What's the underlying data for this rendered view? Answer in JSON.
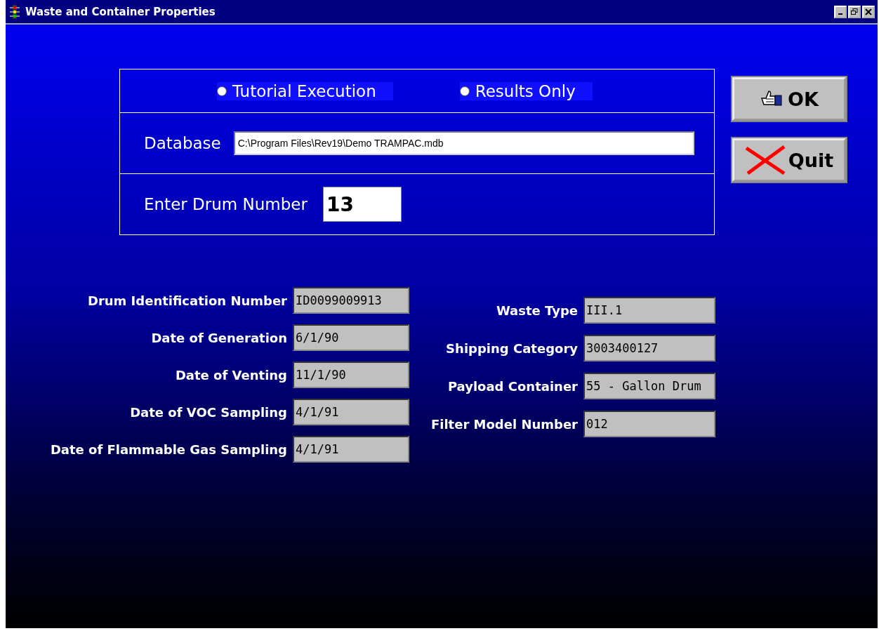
{
  "window": {
    "title": "Waste and Container Properties"
  },
  "modes": [
    {
      "label": "Tutorial Execution",
      "selected": false
    },
    {
      "label": "Results Only",
      "selected": false
    }
  ],
  "database": {
    "label": "Database",
    "value": "C:\\Program Files\\Rev19\\Demo TRAMPAC.mdb"
  },
  "drum_number": {
    "label": "Enter Drum Number",
    "value": "13"
  },
  "buttons": [
    {
      "kind": "ok",
      "label": "OK"
    },
    {
      "kind": "quit",
      "label": "Quit"
    }
  ],
  "left_fields": [
    {
      "label": "Drum Identification Number",
      "value": "ID0099009913"
    },
    {
      "label": "Date of Generation",
      "value": "6/1/90"
    },
    {
      "label": "Date of Venting",
      "value": "11/1/90"
    },
    {
      "label": "Date of VOC Sampling",
      "value": "4/1/91"
    },
    {
      "label": "Date of Flammable Gas Sampling",
      "value": "4/1/91"
    }
  ],
  "right_fields": [
    {
      "label": "Waste Type",
      "value": "III.1"
    },
    {
      "label": "Shipping Category",
      "value": "3003400127"
    },
    {
      "label": "Payload Container",
      "value": "55 - Gallon Drum"
    },
    {
      "label": "Filter Model Number",
      "value": "012"
    }
  ]
}
